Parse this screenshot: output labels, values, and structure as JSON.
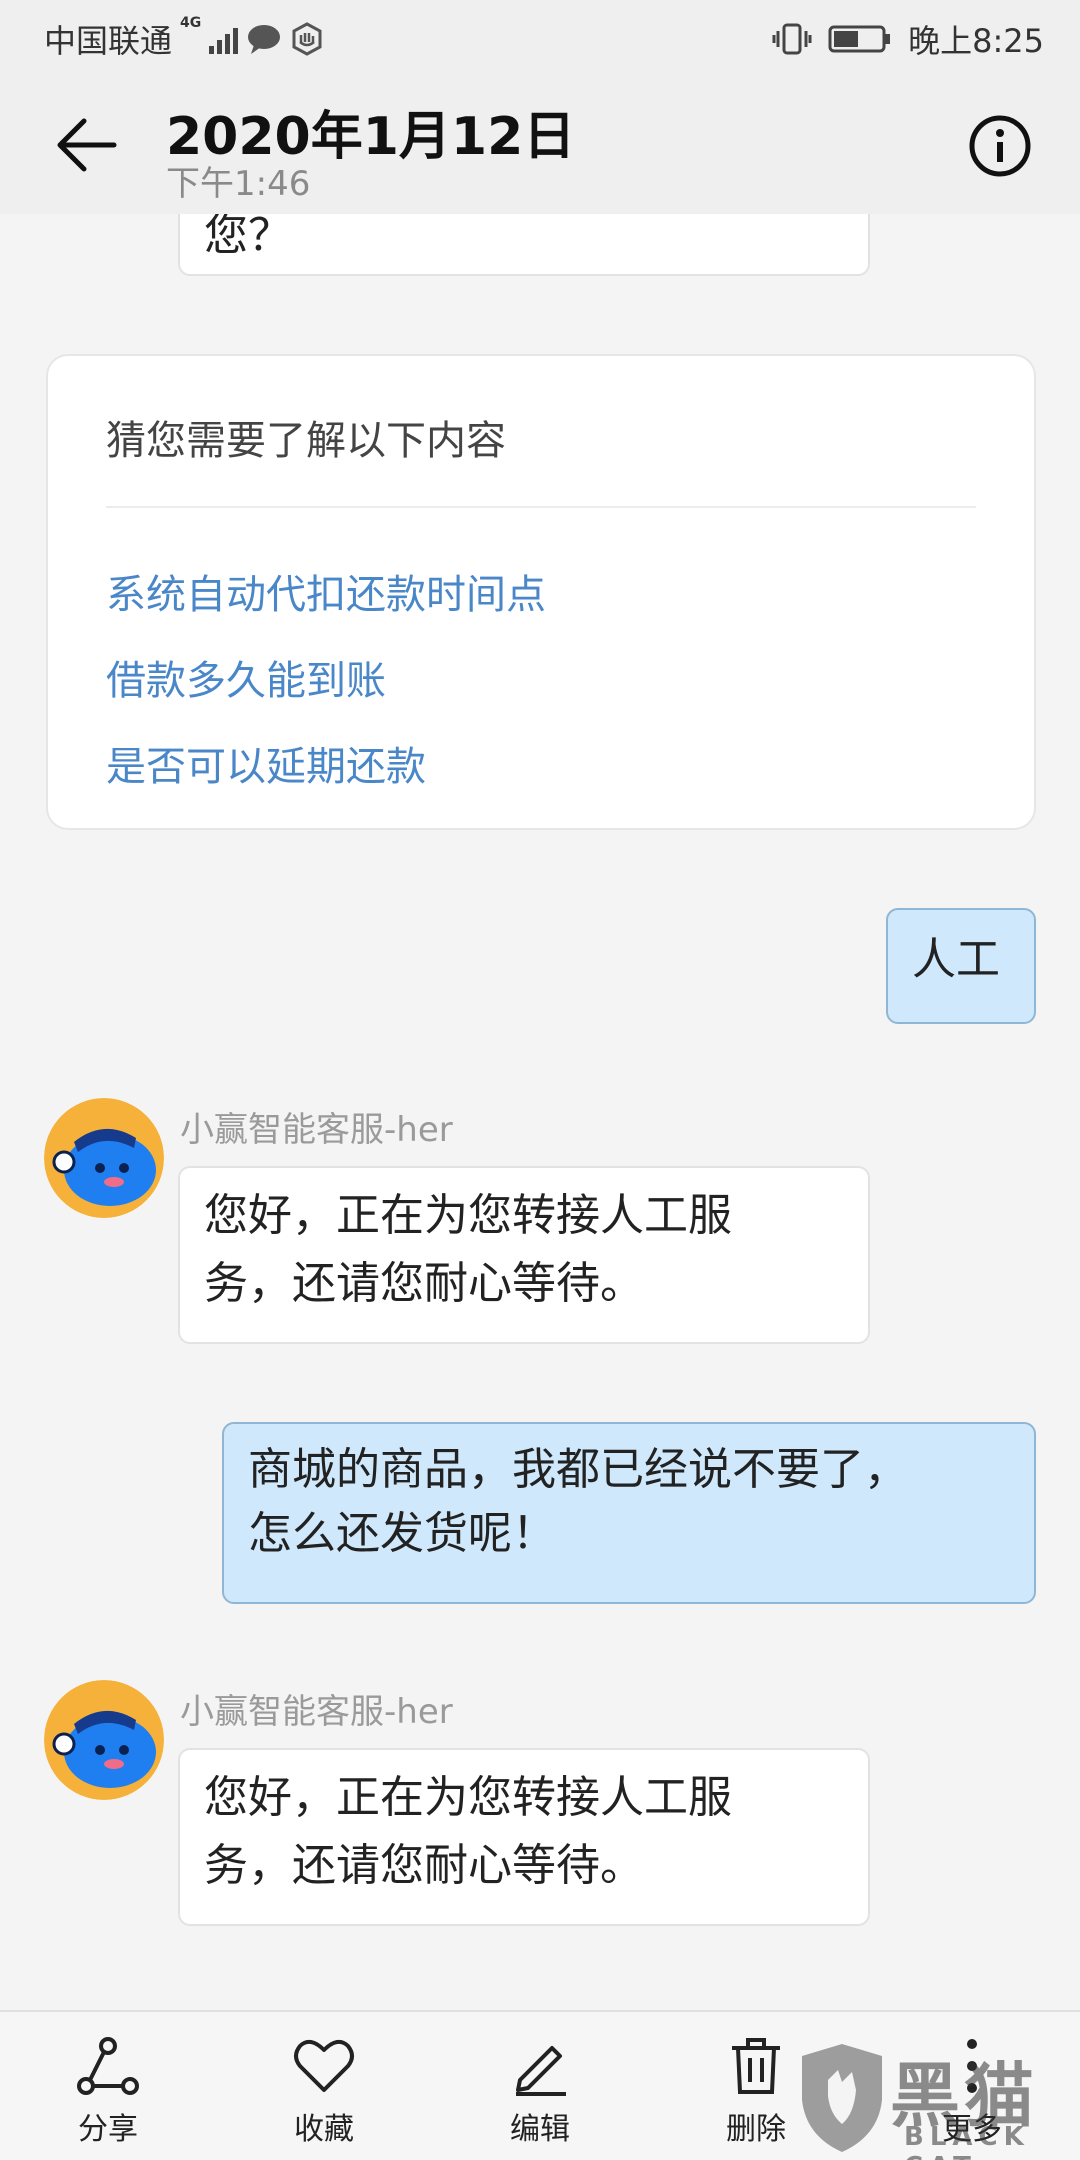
{
  "status_bar": {
    "carrier": "中国联通",
    "network": "4G",
    "time": "晚上8:25"
  },
  "header": {
    "title": "2020年1月12日",
    "subtitle": "下午1:46"
  },
  "messages": {
    "partial_top": "您？",
    "suggestion_card": {
      "title": "猜您需要了解以下内容",
      "links": [
        "系统自动代扣还款时间点",
        "借款多久能到账",
        "是否可以延期还款"
      ]
    },
    "user_1": "人工",
    "bot_1": {
      "sender": "小赢智能客服-her",
      "line1": "您好，正在为您转接人工服",
      "line2": "务，还请您耐心等待。"
    },
    "user_2": {
      "line1": "商城的商品，我都已经说不要了，",
      "line2": "怎么还发货呢！"
    },
    "bot_2": {
      "sender": "小赢智能客服-her",
      "line1": "您好，正在为您转接人工服",
      "line2": "务，还请您耐心等待。"
    }
  },
  "toolbar": {
    "share": "分享",
    "favorite": "收藏",
    "edit": "编辑",
    "delete": "删除",
    "more": "更多"
  },
  "watermark": {
    "main": "黑猫",
    "sub": "BLACK CAT"
  },
  "colors": {
    "link": "#4a87c9",
    "user_bubble": "#cfe8fb",
    "avatar_bg": "#f5b13a",
    "avatar_char": "#1f7ef0"
  }
}
